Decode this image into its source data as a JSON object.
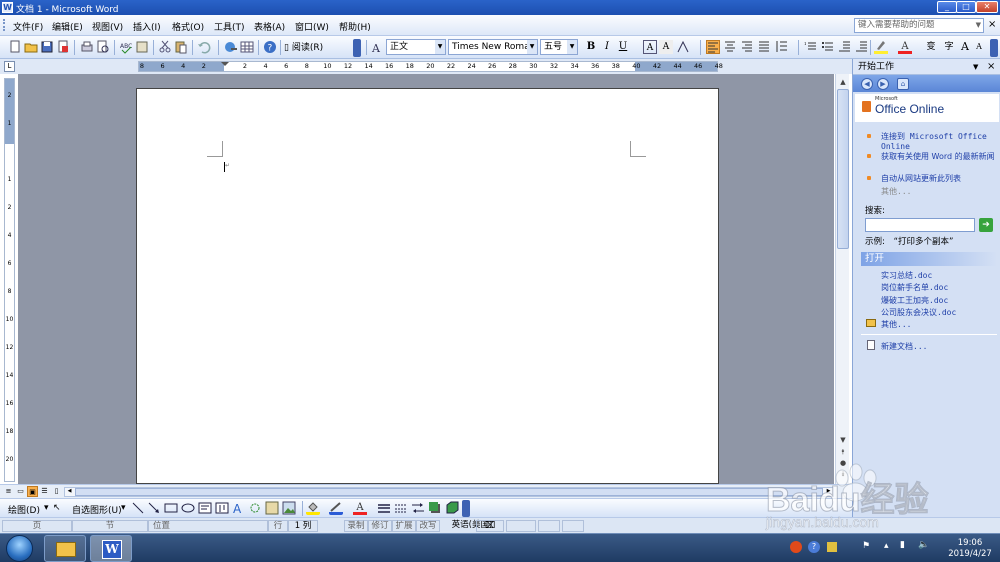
{
  "window": {
    "title": "文档 1 - Microsoft Word"
  },
  "menu": [
    "文件(F)",
    "编辑(E)",
    "视图(V)",
    "插入(I)",
    "格式(O)",
    "工具(T)",
    "表格(A)",
    "窗口(W)",
    "帮助(H)"
  ],
  "help_box": {
    "placeholder": "键入需要帮助的问题"
  },
  "toolbar": {
    "read_button": "阅读(R)",
    "style": "正文",
    "font": "Times New Roman",
    "size": "五号",
    "bold": "B",
    "italic": "I",
    "underline": "U",
    "font_color_glyph": "A",
    "highlight_glyph": "A"
  },
  "ruler": {
    "tab_selector": "L",
    "numbers": [
      "8",
      "6",
      "4",
      "2",
      "",
      "2",
      "4",
      "6",
      "8",
      "10",
      "12",
      "14",
      "16",
      "18",
      "20",
      "22",
      "24",
      "26",
      "28",
      "30",
      "32",
      "34",
      "36",
      "38",
      "40",
      "42",
      "44",
      "46",
      "48"
    ],
    "vertical_numbers": [
      "2",
      "1",
      "",
      "1",
      "2",
      "4",
      "6",
      "8",
      "10",
      "12",
      "14",
      "16",
      "18",
      "20"
    ]
  },
  "task_pane": {
    "title": "开始工作",
    "logo": "Office Online",
    "logo_small": "Microsoft",
    "links": [
      "连接到 Microsoft Office Online",
      "获取有关使用 Word 的最新新闻",
      "自动从网站更新此列表"
    ],
    "more": "其他...",
    "search_label": "搜索:",
    "example_label": "示例:",
    "example_value": "“打印多个副本”",
    "open_header": "打开",
    "files": [
      "实习总结.doc",
      "岗位薪手名单.doc",
      "爆破工王加亮.doc",
      "公司股东会决议.doc"
    ],
    "open_more": "其他...",
    "new_doc": "新建文档..."
  },
  "drawing": {
    "draw_menu": "绘图(D)",
    "autoshapes": "自选图形(U)"
  },
  "status": {
    "page": "页",
    "section": "节",
    "at": "位置",
    "line": "行",
    "col": "1 列",
    "rec": "录制",
    "trk": "修订",
    "ext": "扩展",
    "ovr": "改写",
    "lang": "英语(美国)"
  },
  "taskbar": {
    "time": "19:06",
    "date": "2019/4/27"
  },
  "watermark": {
    "brand": "Baidu经验",
    "url": "jingyan.baidu.com"
  },
  "colors": {
    "title_bar": "#2a63c9",
    "doc_background": "#8f96a6",
    "task_pane": "#d4e0f4",
    "accent_orange": "#f9b04d"
  }
}
